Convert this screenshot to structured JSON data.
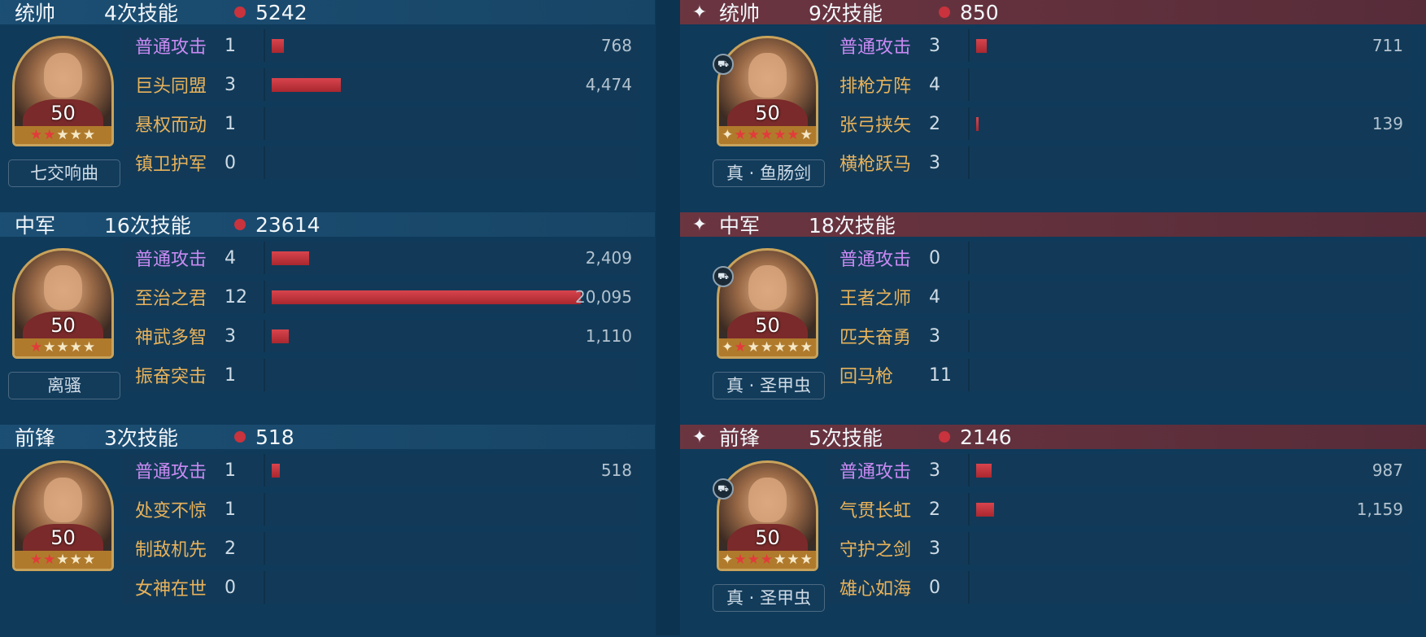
{
  "left": {
    "sections": [
      {
        "role": "统帅",
        "casts": "4次技能",
        "total": "5242",
        "level": "50",
        "equipment": "七交响曲",
        "stars_red": 2,
        "stars_total": 5,
        "skills": [
          {
            "name": "普通攻击",
            "count": "1",
            "value": "768",
            "bar": 768,
            "normal": true
          },
          {
            "name": "巨头同盟",
            "count": "3",
            "value": "4,474",
            "bar": 4474
          },
          {
            "name": "悬权而动",
            "count": "1",
            "value": "",
            "bar": 0
          },
          {
            "name": "镇卫护军",
            "count": "0",
            "value": "",
            "bar": 0
          }
        ]
      },
      {
        "role": "中军",
        "casts": "16次技能",
        "total": "23614",
        "level": "50",
        "equipment": "离骚",
        "stars_red": 1,
        "stars_total": 5,
        "skills": [
          {
            "name": "普通攻击",
            "count": "4",
            "value": "2,409",
            "bar": 2409,
            "normal": true
          },
          {
            "name": "至治之君",
            "count": "12",
            "value": "20,095",
            "bar": 20095
          },
          {
            "name": "神武多智",
            "count": "3",
            "value": "1,110",
            "bar": 1110
          },
          {
            "name": "振奋突击",
            "count": "1",
            "value": "",
            "bar": 0
          }
        ]
      },
      {
        "role": "前锋",
        "casts": "3次技能",
        "total": "518",
        "level": "50",
        "equipment": "",
        "stars_red": 2,
        "stars_total": 5,
        "skills": [
          {
            "name": "普通攻击",
            "count": "1",
            "value": "518",
            "bar": 518,
            "normal": true
          },
          {
            "name": "处变不惊",
            "count": "1",
            "value": "",
            "bar": 0
          },
          {
            "name": "制敌机先",
            "count": "2",
            "value": "",
            "bar": 0
          },
          {
            "name": "女神在世",
            "count": "0",
            "value": "",
            "bar": 0
          }
        ]
      }
    ]
  },
  "right": {
    "sections": [
      {
        "role": "统帅",
        "casts": "9次技能",
        "total": "850",
        "level": "50",
        "equipment": "真 · 鱼肠剑",
        "stars_red": 5,
        "stars_total": 6,
        "skills": [
          {
            "name": "普通攻击",
            "count": "3",
            "value": "711",
            "bar": 711,
            "normal": true
          },
          {
            "name": "排枪方阵",
            "count": "4",
            "value": "",
            "bar": 0
          },
          {
            "name": "张弓挟矢",
            "count": "2",
            "value": "139",
            "bar": 139
          },
          {
            "name": "横枪跃马",
            "count": "3",
            "value": "",
            "bar": 0
          }
        ]
      },
      {
        "role": "中军",
        "casts": "18次技能",
        "total": "",
        "level": "50",
        "equipment": "真 · 圣甲虫",
        "stars_red": 1,
        "stars_total": 6,
        "skills": [
          {
            "name": "普通攻击",
            "count": "0",
            "value": "",
            "bar": 0,
            "normal": true
          },
          {
            "name": "王者之师",
            "count": "4",
            "value": "",
            "bar": 0
          },
          {
            "name": "匹夫奋勇",
            "count": "3",
            "value": "",
            "bar": 0
          },
          {
            "name": "回马枪",
            "count": "11",
            "value": "",
            "bar": 0
          }
        ]
      },
      {
        "role": "前锋",
        "casts": "5次技能",
        "total": "2146",
        "level": "50",
        "equipment": "真 · 圣甲虫",
        "stars_red": 3,
        "stars_total": 6,
        "skills": [
          {
            "name": "普通攻击",
            "count": "3",
            "value": "987",
            "bar": 987,
            "normal": true
          },
          {
            "name": "气贯长虹",
            "count": "2",
            "value": "1,159",
            "bar": 1159
          },
          {
            "name": "守护之剑",
            "count": "3",
            "value": "",
            "bar": 0
          },
          {
            "name": "雄心如海",
            "count": "0",
            "value": "",
            "bar": 0
          }
        ]
      }
    ]
  },
  "bar_scale_max": 20095,
  "colors": {
    "left_header": "#1c4f74",
    "right_header": "#6b3540",
    "bar": "#c8333d",
    "skill_name": "#e9b25a",
    "normal_attack": "#c98af2"
  },
  "icons": {
    "header": "sparkle-icon",
    "dot": "damage-dot-icon",
    "troop": "troop-type-icon"
  }
}
